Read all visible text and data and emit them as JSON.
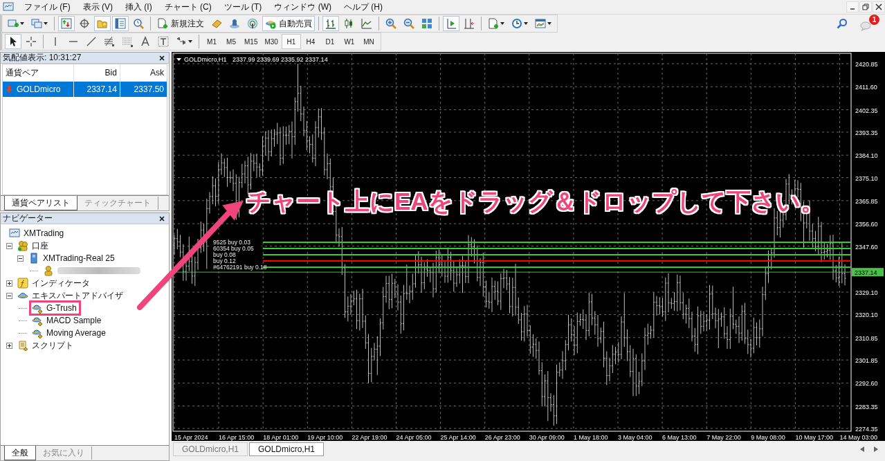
{
  "menu": [
    "ファイル (F)",
    "表示 (V)",
    "挿入 (I)",
    "チャート (C)",
    "ツール (T)",
    "ウィンドウ (W)",
    "ヘルプ (H)"
  ],
  "toolbar_main": [
    {
      "items": [
        {
          "kind": "new-chart",
          "pressed": false
        },
        {
          "kind": "profiles",
          "pressed": false
        }
      ]
    },
    {
      "items": [
        {
          "kind": "market-watch",
          "pressed": true
        },
        {
          "kind": "data-window",
          "pressed": false
        },
        {
          "kind": "navigator",
          "pressed": true
        },
        {
          "kind": "terminal",
          "pressed": true
        },
        {
          "kind": "tester",
          "pressed": false
        }
      ]
    },
    {
      "items": [
        {
          "kind": "new-order",
          "label": "新規注文",
          "pressed": false
        },
        {
          "kind": "metaeditor",
          "pressed": false
        },
        {
          "kind": "community",
          "pressed": false
        },
        {
          "kind": "signals",
          "pressed": false
        },
        {
          "kind": "auto-trading",
          "label": "自動売買",
          "pressed": true
        }
      ]
    },
    {
      "items": [
        {
          "kind": "bar-chart",
          "pressed": true
        },
        {
          "kind": "candle-chart",
          "pressed": false
        },
        {
          "kind": "line-chart",
          "pressed": false
        }
      ]
    },
    {
      "items": [
        {
          "kind": "zoom-in",
          "pressed": false
        },
        {
          "kind": "zoom-out",
          "pressed": false
        },
        {
          "kind": "tile",
          "pressed": false
        }
      ]
    },
    {
      "items": [
        {
          "kind": "autoscroll",
          "pressed": true
        },
        {
          "kind": "chart-shift",
          "pressed": false
        }
      ]
    },
    {
      "items": [
        {
          "kind": "indicators",
          "pressed": false
        },
        {
          "kind": "periods",
          "pressed": false
        },
        {
          "kind": "templates",
          "pressed": false
        }
      ]
    }
  ],
  "notification_count": "1",
  "toolbar_draw": [
    {
      "items": [
        {
          "kind": "cursor",
          "pressed": true
        },
        {
          "kind": "crosshair",
          "pressed": false
        }
      ]
    },
    {
      "items": [
        {
          "kind": "vline",
          "pressed": false
        },
        {
          "kind": "hline",
          "pressed": false
        },
        {
          "kind": "trendline",
          "pressed": false
        },
        {
          "kind": "fibo",
          "pressed": false
        },
        {
          "kind": "fibo-lines",
          "pressed": false
        },
        {
          "kind": "text",
          "pressed": false
        },
        {
          "kind": "label",
          "pressed": false
        },
        {
          "kind": "arrows",
          "pressed": false
        }
      ]
    }
  ],
  "timeframes": [
    {
      "label": "M1",
      "selected": false
    },
    {
      "label": "M5",
      "selected": false
    },
    {
      "label": "M15",
      "selected": false
    },
    {
      "label": "M30",
      "selected": false
    },
    {
      "label": "H1",
      "selected": true
    },
    {
      "label": "H4",
      "selected": false
    },
    {
      "label": "D1",
      "selected": false
    },
    {
      "label": "W1",
      "selected": false
    },
    {
      "label": "MN",
      "selected": false
    }
  ],
  "market_watch": {
    "title": "気配値表示: 10:31:27",
    "columns": [
      "通貨ペア",
      "Bid",
      "Ask"
    ],
    "rows": [
      {
        "symbol": "GOLDmicro",
        "bid": "2337.14",
        "ask": "2337.50",
        "falling": true,
        "selected": true
      }
    ],
    "tabs": [
      {
        "label": "通貨ペアリスト",
        "selected": true
      },
      {
        "label": "ティックチャート",
        "selected": false
      }
    ]
  },
  "navigator": {
    "title": "ナビゲーター",
    "tree": [
      {
        "kind": "terminal",
        "label": "XMTrading",
        "highlighted": false,
        "children": [
          {
            "kind": "accounts",
            "label": "口座",
            "highlighted": false,
            "expanded": true,
            "children": [
              {
                "kind": "server",
                "label": "XMTrading-Real 25",
                "highlighted": false,
                "expanded": true,
                "children": [
                  {
                    "kind": "account",
                    "highlighted": false
                  }
                ]
              }
            ]
          },
          {
            "kind": "indicators",
            "label": "インディケータ",
            "highlighted": false,
            "expanded": false
          },
          {
            "kind": "experts",
            "label": "エキスパートアドバイザ",
            "highlighted": false,
            "expanded": true,
            "children": [
              {
                "kind": "expert",
                "label": "G-Trush",
                "highlighted": true
              },
              {
                "kind": "expert",
                "label": "MACD Sample",
                "highlighted": false
              },
              {
                "kind": "expert",
                "label": "Moving Average",
                "highlighted": false
              }
            ]
          },
          {
            "kind": "scripts",
            "label": "スクリプト",
            "highlighted": false,
            "expanded": false
          }
        ]
      }
    ],
    "tabs": [
      {
        "label": "全般",
        "selected": true
      },
      {
        "label": "お気に入り",
        "selected": false
      }
    ]
  },
  "chart": {
    "symbol": "GOLDmicro,H1",
    "ohlc": "2337.99 2339.69 2335.92 2337.14",
    "price_labels": [
      "2420.85",
      "2411.60",
      "2402.35",
      "2393.35",
      "2384.10",
      "2375.10",
      "2365.85",
      "2356.60",
      "2347.60",
      "2329.10",
      "2320.10",
      "2310.85",
      "2301.85",
      "2292.60",
      "2283.35",
      "2274.35"
    ],
    "current_price": "2337.14",
    "time_labels": [
      "15 Apr 2024",
      "16 Apr 15:00",
      "18 Apr 01:00",
      "19 Apr 10:00",
      "22 Apr 19:00",
      "24 Apr 05:00",
      "25 Apr 14:00",
      "26 Apr 23:00",
      "30 Apr 09:00",
      "1 May 18:00",
      "3 May 04:00",
      "6 May 13:00",
      "7 May 22:00",
      "9 May 08:00",
      "10 May 17:00",
      "14 May 03:00"
    ],
    "orders": [
      {
        "label": "9525 buy 0.03",
        "color": "#33cc33"
      },
      {
        "label": "60354 buy 0.05",
        "color": "#33cc33"
      },
      {
        "label": "buy 0.08",
        "color": "#33cc33"
      },
      {
        "label": "buy 0.12",
        "color": "#ff0000"
      },
      {
        "label": "#64762191 buy 0.18",
        "color": "#33cc33"
      }
    ]
  },
  "chart_tabs": [
    {
      "label": "GOLDmicro,H1",
      "selected": false
    },
    {
      "label": "GOLDmicro,H1",
      "selected": true
    }
  ],
  "callout": {
    "text": "チャート上にEAをドラッグ＆ドロップして下さい。"
  }
}
